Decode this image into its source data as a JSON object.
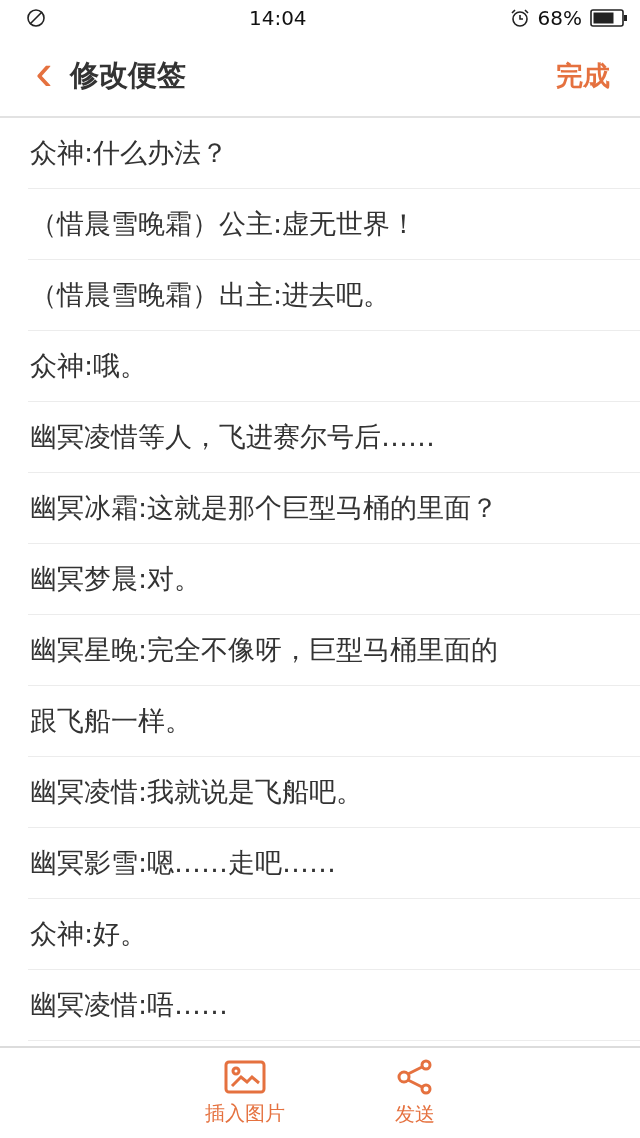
{
  "status_bar": {
    "time": "14:04",
    "battery": "68%"
  },
  "header": {
    "back": "‹",
    "title": "修改便签",
    "done": "完成"
  },
  "note_lines": [
    "众神:什么办法？",
    "（惜晨雪晚霜）公主:虚无世界！",
    "（惜晨雪晚霜）出主:进去吧。",
    "众神:哦。",
    "幽冥凌惜等人，飞进赛尔号后……",
    "幽冥冰霜:这就是那个巨型马桶的里面？",
    "幽冥梦晨:对。",
    "幽冥星晚:完全不像呀，巨型马桶里面的",
    "跟飞船一样。",
    "幽冥凌惜:我就说是飞船吧。",
    "幽冥影雪:嗯……走吧……",
    "众神:好。",
    "幽冥凌惜:唔……"
  ],
  "toolbar": [
    {
      "kind": "image",
      "label": "插入图片"
    },
    {
      "kind": "share",
      "label": "发送"
    }
  ]
}
